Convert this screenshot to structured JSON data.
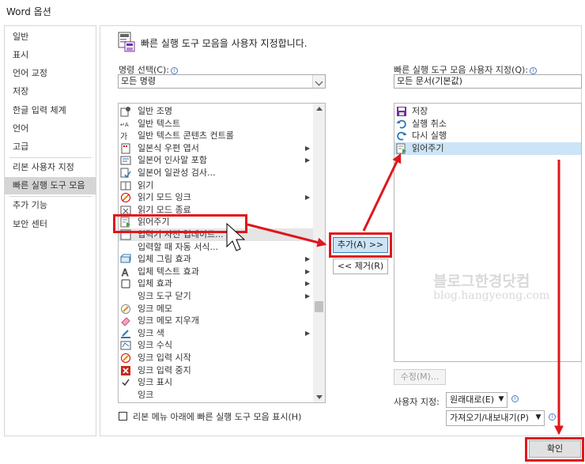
{
  "window": {
    "title": "Word 옵션"
  },
  "nav": {
    "items": [
      {
        "label": "일반"
      },
      {
        "label": "표시"
      },
      {
        "label": "언어 교정"
      },
      {
        "label": "저장"
      },
      {
        "label": "한글 입력 체계"
      },
      {
        "label": "언어"
      },
      {
        "label": "고급"
      },
      {
        "label": "리본 사용자 지정"
      },
      {
        "label": "빠른 실행 도구 모음",
        "selected": true
      },
      {
        "label": "추가 기능"
      },
      {
        "label": "보안 센터"
      }
    ]
  },
  "header": {
    "title": "빠른 실행 도구 모음을 사용자 지정합니다."
  },
  "left": {
    "label": "명령 선택(C):",
    "combo_value": "모든 명령",
    "commands": [
      {
        "label": "일반 조명",
        "icon": "general-light-icon"
      },
      {
        "label": "일반 텍스트",
        "icon": "plain-text-icon"
      },
      {
        "label": "일반 텍스트 콘텐츠 컨트롤",
        "icon": "content-control-icon"
      },
      {
        "label": "일본식 우편 엽서",
        "icon": "postcard-icon",
        "sub": true
      },
      {
        "label": "일본어 인사말 포함",
        "icon": "greeting-icon",
        "sub": true
      },
      {
        "label": "일본어 일관성 검사...",
        "icon": "consistency-check-icon"
      },
      {
        "label": "읽기",
        "icon": "read-icon"
      },
      {
        "label": "읽기 모드 잉크",
        "icon": "read-mode-ink-icon",
        "sub": true
      },
      {
        "label": "읽기 모드 종료",
        "icon": "close-read-mode-icon"
      },
      {
        "label": "읽어주기",
        "icon": "read-aloud-icon"
      },
      {
        "label": "입력기 사전 업데이트...",
        "icon": "ime-update-icon"
      },
      {
        "label": "입력할 때 자동 서식...",
        "icon": "autoformat-icon"
      },
      {
        "label": "입체 그림 효과",
        "icon": "3d-picture-icon",
        "sub": true
      },
      {
        "label": "입체 텍스트 효과",
        "icon": "3d-text-icon",
        "sub": true
      },
      {
        "label": "입체 효과",
        "icon": "3d-effect-icon",
        "sub": true
      },
      {
        "label": "잉크 도구 닫기",
        "icon": "close-ink-icon",
        "sub": true
      },
      {
        "label": "잉크 메모",
        "icon": "ink-memo-icon"
      },
      {
        "label": "잉크 메모 지우개",
        "icon": "eraser-icon"
      },
      {
        "label": "잉크 색",
        "icon": "ink-color-icon",
        "sub": true
      },
      {
        "label": "잉크 수식",
        "icon": "ink-equation-icon"
      },
      {
        "label": "잉크 입력 시작",
        "icon": "ink-start-icon"
      },
      {
        "label": "잉크 입력 중지",
        "icon": "ink-stop-icon"
      },
      {
        "label": "잉크 표시",
        "icon": "ink-show-icon"
      },
      {
        "label": "잉크",
        "icon": "ink-icon"
      }
    ],
    "checkbox_label": "리본 메뉴 아래에 빠른 실행 도구 모음 표시(H)"
  },
  "middle": {
    "add_button": "추가(A) >>",
    "remove_button": "<< 제거(R)"
  },
  "right": {
    "label": "빠른 실행 도구 모음 사용자 지정(Q):",
    "combo_value": "모든 문서(기본값)",
    "items": [
      {
        "label": "저장",
        "icon": "save-icon"
      },
      {
        "label": "실행 취소",
        "icon": "undo-icon"
      },
      {
        "label": "다시 실행",
        "icon": "redo-icon"
      },
      {
        "label": "읽어주기",
        "icon": "read-aloud-icon"
      }
    ],
    "modify_button": "수정(M)...",
    "customize_label": "사용자 지정:",
    "reset_button": "원래대로(E)",
    "import_export_button": "가져오기/내보내기(P)"
  },
  "watermark": {
    "line1": "블로그한경닷컴",
    "line2": "blog.hangyeong.com"
  },
  "ok_button": "확인",
  "colors": {
    "highlight_red": "#e0161d",
    "selection_blue": "#cce4f7",
    "nav_selected": "#d5d5d5"
  }
}
